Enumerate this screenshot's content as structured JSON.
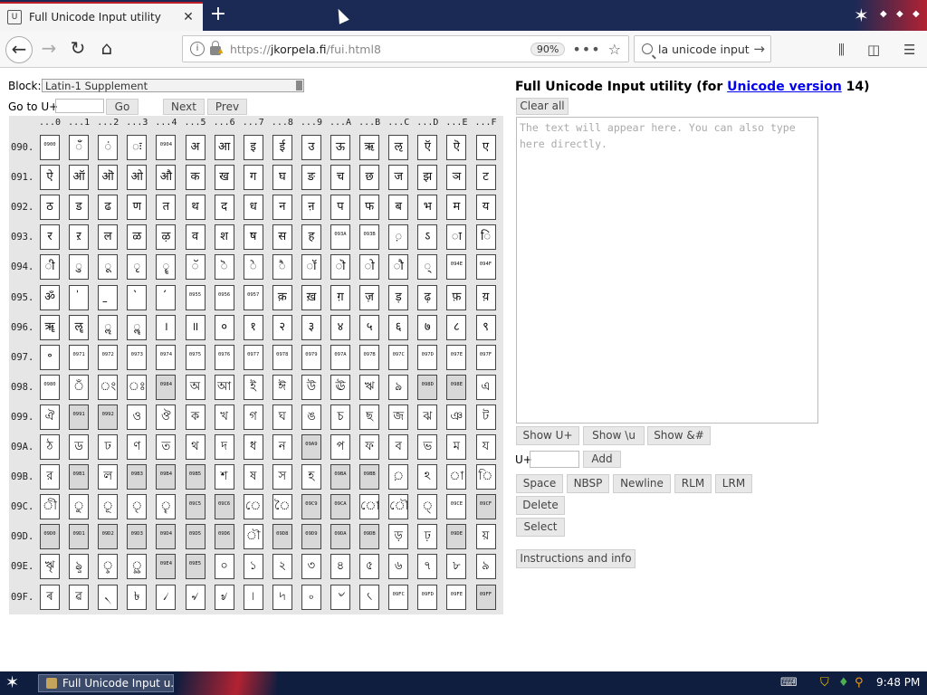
{
  "browser": {
    "tab_title": "Full Unicode Input utility",
    "url_prefix": "https://",
    "url_host": "jkorpela.fi",
    "url_path": "/fui.html8",
    "zoom": "90%",
    "search_text": "la unicode input"
  },
  "page": {
    "block_label": "Block:",
    "block_value": "Latin-1 Supplement",
    "goto_label": "Go to U+",
    "go_button": "Go",
    "next_button": "Next",
    "prev_button": "Prev",
    "title_prefix": "Full Unicode Input utility (for ",
    "title_link": "Unicode version",
    "title_suffix": " 14)",
    "clear_all": "Clear all",
    "textarea_placeholder": "The text will appear here. You can also type here directly.",
    "show_uplus": "Show U+",
    "show_u": "Show \\u",
    "show_amp": "Show &#",
    "uplus_label": "U+",
    "add_button": "Add",
    "space_button": "Space",
    "nbsp_button": "NBSP",
    "newline_button": "Newline",
    "rlm_button": "RLM",
    "lrm_button": "LRM",
    "delete_button": "Delete",
    "select_button": "Select",
    "instructions_button": "Instructions and info"
  },
  "grid": {
    "column_headers": [
      "...0",
      "...1",
      "...2",
      "...3",
      "...4",
      "...5",
      "...6",
      "...7",
      "...8",
      "...9",
      "...A",
      "...B",
      "...C",
      "...D",
      "...E",
      "...F"
    ],
    "rows": [
      {
        "label": "090.",
        "cells": [
          "0900",
          "ँ",
          "ं",
          "ः",
          "0904",
          "अ",
          "आ",
          "इ",
          "ई",
          "उ",
          "ऊ",
          "ऋ",
          "ऌ",
          "ऍ",
          "ऎ",
          "ए"
        ]
      },
      {
        "label": "091.",
        "cells": [
          "ऐ",
          "ऑ",
          "ऒ",
          "ओ",
          "औ",
          "क",
          "ख",
          "ग",
          "घ",
          "ङ",
          "च",
          "छ",
          "ज",
          "झ",
          "ञ",
          "ट"
        ]
      },
      {
        "label": "092.",
        "cells": [
          "ठ",
          "ड",
          "ढ",
          "ण",
          "त",
          "थ",
          "द",
          "ध",
          "न",
          "ऩ",
          "प",
          "फ",
          "ब",
          "भ",
          "म",
          "य"
        ]
      },
      {
        "label": "093.",
        "cells": [
          "र",
          "ऱ",
          "ल",
          "ळ",
          "ऴ",
          "व",
          "श",
          "ष",
          "स",
          "ह",
          "093A",
          "093B",
          "़",
          "ऽ",
          "ा",
          "ि"
        ]
      },
      {
        "label": "094.",
        "cells": [
          "ी",
          "ु",
          "ू",
          "ृ",
          "ॄ",
          "ॅ",
          "ॆ",
          "े",
          "ै",
          "ॉ",
          "ॊ",
          "ो",
          "ौ",
          "्",
          "094E",
          "094F"
        ]
      },
      {
        "label": "095.",
        "cells": [
          "ॐ",
          "॑",
          "॒",
          "॓",
          "॔",
          "0955",
          "0956",
          "0957",
          "क़",
          "ख़",
          "ग़",
          "ज़",
          "ड़",
          "ढ़",
          "फ़",
          "य़"
        ]
      },
      {
        "label": "096.",
        "cells": [
          "ॠ",
          "ॡ",
          "ॢ",
          "ॣ",
          "।",
          "॥",
          "०",
          "१",
          "२",
          "३",
          "४",
          "५",
          "६",
          "७",
          "८",
          "९"
        ]
      },
      {
        "label": "097.",
        "cells": [
          "॰",
          "0971",
          "0972",
          "0973",
          "0974",
          "0975",
          "0976",
          "0977",
          "0978",
          "0979",
          "097A",
          "097B",
          "097C",
          "097D",
          "097E",
          "097F"
        ]
      },
      {
        "label": "098.",
        "cells": [
          "0980",
          "ঁ",
          "ং",
          "ঃ",
          "0984",
          "অ",
          "আ",
          "ই",
          "ঈ",
          "উ",
          "ঊ",
          "ঋ",
          "ঌ",
          "098D",
          "098E",
          "এ"
        ]
      },
      {
        "label": "099.",
        "cells": [
          "ঐ",
          "0991",
          "0992",
          "ও",
          "ঔ",
          "ক",
          "খ",
          "গ",
          "ঘ",
          "ঙ",
          "চ",
          "ছ",
          "জ",
          "ঝ",
          "ঞ",
          "ট"
        ]
      },
      {
        "label": "09A.",
        "cells": [
          "ঠ",
          "ড",
          "ঢ",
          "ণ",
          "ত",
          "থ",
          "দ",
          "ধ",
          "ন",
          "09A9",
          "প",
          "ফ",
          "ব",
          "ভ",
          "ম",
          "য"
        ]
      },
      {
        "label": "09B.",
        "cells": [
          "র",
          "09B1",
          "ল",
          "09B3",
          "09B4",
          "09B5",
          "শ",
          "ষ",
          "স",
          "হ",
          "09BA",
          "09BB",
          "়",
          "ঽ",
          "া",
          "ি"
        ]
      },
      {
        "label": "09C.",
        "cells": [
          "ী",
          "ু",
          "ূ",
          "ৃ",
          "ৄ",
          "09C5",
          "09C6",
          "ে",
          "ৈ",
          "09C9",
          "09CA",
          "ো",
          "ৌ",
          "্",
          "09CE",
          "09CF"
        ]
      },
      {
        "label": "09D.",
        "cells": [
          "09D0",
          "09D1",
          "09D2",
          "09D3",
          "09D4",
          "09D5",
          "09D6",
          "ৗ",
          "09D8",
          "09D9",
          "09DA",
          "09DB",
          "ড়",
          "ঢ়",
          "09DE",
          "য়"
        ]
      },
      {
        "label": "09E.",
        "cells": [
          "ৠ",
          "ৡ",
          "ৢ",
          "ৣ",
          "09E4",
          "09E5",
          "০",
          "১",
          "২",
          "৩",
          "৪",
          "৫",
          "৬",
          "৭",
          "৮",
          "৯"
        ]
      },
      {
        "label": "09F.",
        "cells": [
          "ৰ",
          "ৱ",
          "৲",
          "৳",
          "৴",
          "৵",
          "৶",
          "৷",
          "৸",
          "৹",
          "৺",
          "৻",
          "09FC",
          "09FD",
          "09FE",
          "09FF"
        ]
      }
    ],
    "unassigned_cells": [
      "0984",
      "098D",
      "098E",
      "0991",
      "0992",
      "09A9",
      "09B1",
      "09B3",
      "09B4",
      "09B5",
      "09BA",
      "09BB",
      "09C5",
      "09C6",
      "09C9",
      "09CA",
      "09CF",
      "09D0",
      "09D1",
      "09D2",
      "09D3",
      "09D4",
      "09D5",
      "09D6",
      "09D8",
      "09D9",
      "09DA",
      "09DB",
      "09DE",
      "09E4",
      "09E5",
      "09FF"
    ]
  },
  "taskbar": {
    "task_label": "Full Unicode Input u...",
    "clock": "9:48 PM"
  },
  "colors": {
    "tabstrip": "#1b2a55",
    "link": "#0000ee",
    "taskbar": "#0f1e3f",
    "unassigned_cell": "#d8d8d8"
  }
}
